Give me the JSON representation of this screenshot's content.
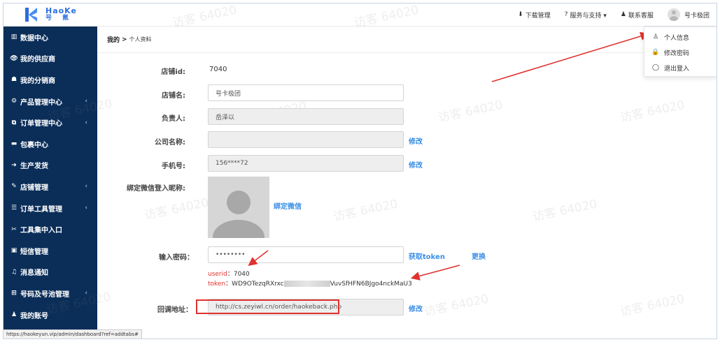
{
  "logo": {
    "en": "HaoKe",
    "cn": "号 氪"
  },
  "sidebar": {
    "items": [
      {
        "icon": "▥",
        "label": "数据中心",
        "arrow": ""
      },
      {
        "icon": "👁",
        "label": "我的供应商",
        "arrow": ""
      },
      {
        "icon": "☗",
        "label": "我的分销商",
        "arrow": ""
      },
      {
        "icon": "⚙",
        "label": "产品管理中心",
        "arrow": "‹"
      },
      {
        "icon": "⧉",
        "label": "订单管理中心",
        "arrow": "‹"
      },
      {
        "icon": "▬",
        "label": "包裹中心",
        "arrow": ""
      },
      {
        "icon": "➜",
        "label": "生产发货",
        "arrow": ""
      },
      {
        "icon": "✎",
        "label": "店铺管理",
        "arrow": "‹"
      },
      {
        "icon": "☰",
        "label": "订单工具管理",
        "arrow": "‹"
      },
      {
        "icon": "✂",
        "label": "工具集中入口",
        "arrow": ""
      },
      {
        "icon": "▣",
        "label": "短信管理",
        "arrow": ""
      },
      {
        "icon": "♫",
        "label": "消息通知",
        "arrow": ""
      },
      {
        "icon": "⊞",
        "label": "号码及号池管理",
        "arrow": "‹"
      },
      {
        "icon": "♟",
        "label": "我的账号",
        "arrow": ""
      }
    ]
  },
  "topbar": {
    "download": "下载管理",
    "download_icon": "⬇",
    "service": "服务与支持 ▾",
    "service_icon": "?",
    "contact": "联系客服",
    "contact_icon": "♟",
    "user_name": "号卡极团"
  },
  "dropdown": {
    "items": [
      {
        "icon": "♙",
        "label": "个人信息"
      },
      {
        "icon": "🔒",
        "label": "修改密码"
      },
      {
        "icon": "◯",
        "label": "退出登入"
      }
    ]
  },
  "breadcrumb": {
    "root": "我的",
    "sep": ">",
    "current": "个人资料"
  },
  "form": {
    "shop_id_label": "店铺id:",
    "shop_id_value": "7040",
    "shop_name_label": "店铺名:",
    "shop_name_value": "号卡极团",
    "owner_label": "负责人:",
    "owner_value": "岳泽以",
    "company_label": "公司名称:",
    "company_value": "",
    "company_edit": "修改",
    "phone_label": "手机号:",
    "phone_value": "156****72",
    "phone_edit": "修改",
    "wechat_label": "绑定微信登入昵称:",
    "wechat_bind": "绑定微信",
    "password_label": "输入密码：",
    "password_value": "••••••••",
    "get_token": "获取token",
    "replace": "更换",
    "userid_key": "userid",
    "userid_value": "：7040",
    "token_key": "token",
    "token_value_a": "：WD9OTezqRXrxc",
    "token_value_b": "VuvSfHFN6BJgo4nckMaU3",
    "callback_label": "回调地址：",
    "callback_value": "http://cs.zeyiwl.cn/order/haokeback.php",
    "callback_edit": "修改"
  },
  "watermark_text": "访客 64020",
  "status_url": "https://haokeyun.vip/admin/dashboard?ref=addtabs#",
  "colors": {
    "sidebar": "#0b2e59",
    "link": "#3a8ee6",
    "annotation": "#e0322f"
  }
}
